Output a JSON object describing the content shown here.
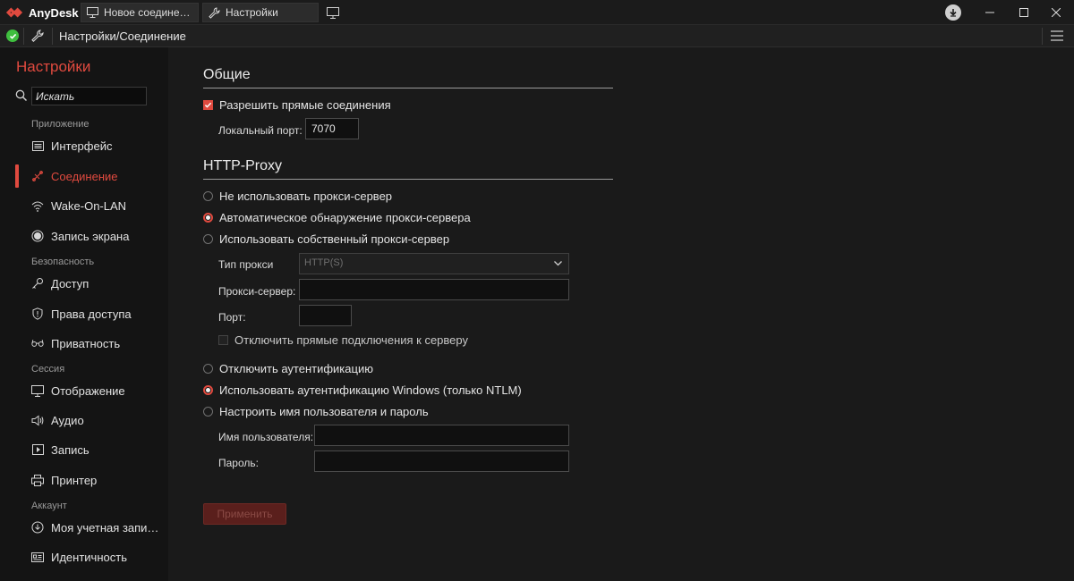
{
  "app": {
    "name": "AnyDesk",
    "tabs": [
      {
        "label": "Новое соедине…",
        "icon": "monitor-icon"
      },
      {
        "label": "Настройки",
        "icon": "wrench-icon"
      }
    ],
    "new_tab_icon": "monitor-plus-icon",
    "window_controls": {
      "minimize": "—",
      "maximize": "☐",
      "close": "✕"
    }
  },
  "address_bar": {
    "status": "connected",
    "path": "Настройки/Соединение"
  },
  "sidebar": {
    "title": "Настройки",
    "search_value": "Искать",
    "sections": [
      {
        "label": "Приложение"
      },
      {
        "label": "Безопасность"
      },
      {
        "label": "Сессия"
      },
      {
        "label": "Аккаунт"
      }
    ],
    "items": [
      {
        "label": "Интерфейс",
        "icon": "interface-icon"
      },
      {
        "label": "Соединение",
        "icon": "connection-icon",
        "active": true
      },
      {
        "label": "Wake-On-LAN",
        "icon": "wifi-icon"
      },
      {
        "label": "Запись экрана",
        "icon": "record-icon"
      },
      {
        "label": "Доступ",
        "icon": "key-icon"
      },
      {
        "label": "Права доступа",
        "icon": "shield-icon"
      },
      {
        "label": "Приватность",
        "icon": "glasses-icon"
      },
      {
        "label": "Отображение",
        "icon": "display-icon"
      },
      {
        "label": "Аудио",
        "icon": "speaker-icon"
      },
      {
        "label": "Запись",
        "icon": "play-icon"
      },
      {
        "label": "Принтер",
        "icon": "printer-icon"
      },
      {
        "label": "Моя учетная запи…",
        "icon": "account-icon"
      },
      {
        "label": "Идентичность",
        "icon": "id-card-icon"
      }
    ]
  },
  "general": {
    "title": "Общие",
    "allow_direct_label": "Разрешить прямые соединения",
    "allow_direct_checked": true,
    "local_port_label": "Локальный порт:",
    "local_port_value": "7070"
  },
  "proxy": {
    "title": "HTTP-Proxy",
    "mode_options": [
      {
        "label": "Не использовать прокси-сервер",
        "selected": false
      },
      {
        "label": "Автоматическое обнаружение прокси-сервера",
        "selected": true
      },
      {
        "label": "Использовать собственный прокси-сервер",
        "selected": false
      }
    ],
    "type_label": "Тип прокси",
    "type_value": "HTTP(S)",
    "server_label": "Прокси-сервер:",
    "server_value": "",
    "port_label": "Порт:",
    "port_value": "",
    "disable_direct_label": "Отключить прямые подключения к серверу",
    "auth_options": [
      {
        "label": "Отключить аутентификацию",
        "selected": false
      },
      {
        "label": "Использовать аутентификацию Windows (только NTLM)",
        "selected": true
      },
      {
        "label": "Настроить имя пользователя и пароль",
        "selected": false
      }
    ],
    "username_label": "Имя пользователя:",
    "username_value": "",
    "password_label": "Пароль:",
    "password_value": ""
  },
  "apply_label": "Применить",
  "colors": {
    "accent": "#e04a3f",
    "background": "#1a1a1a",
    "sidebar": "#141414"
  }
}
